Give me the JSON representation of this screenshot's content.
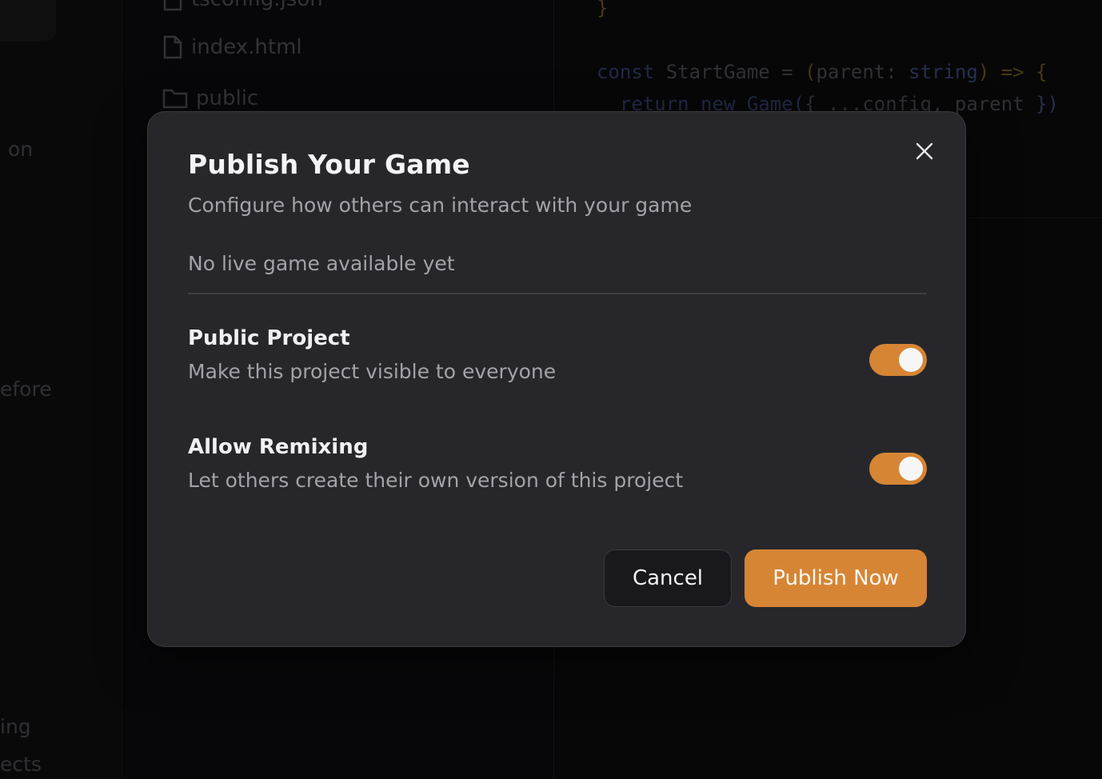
{
  "background": {
    "left_fragments": [
      "on",
      "efore",
      "ing",
      "ects"
    ],
    "file_tree": [
      {
        "name": "tsconfig.json",
        "icon": "file-icon"
      },
      {
        "name": "index.html",
        "icon": "file-icon"
      },
      {
        "name": "public",
        "icon": "folder-icon"
      }
    ],
    "code": {
      "line1": "}",
      "line2_a": "const",
      "line2_b": " StartGame = ",
      "line2_c": "(",
      "line2_d": "parent: ",
      "line2_e": "string",
      "line2_f": ") => ",
      "line2_g": "{",
      "line3_a": "  return new Game(",
      "line3_b": "{ ...config, parent ",
      "line3_c": "})"
    }
  },
  "modal": {
    "title": "Publish Your Game",
    "subtitle": "Configure how others can interact with your game",
    "status": "No live game available yet",
    "close_icon": "close-icon",
    "settings": [
      {
        "title": "Public Project",
        "description": "Make this project visible to everyone",
        "enabled": true
      },
      {
        "title": "Allow Remixing",
        "description": "Let others create their own version of this project",
        "enabled": true
      }
    ],
    "cancel_label": "Cancel",
    "publish_label": "Publish Now"
  },
  "colors": {
    "accent": "#d68535",
    "modal_bg": "#27272b",
    "page_bg": "#0d0d0f"
  }
}
